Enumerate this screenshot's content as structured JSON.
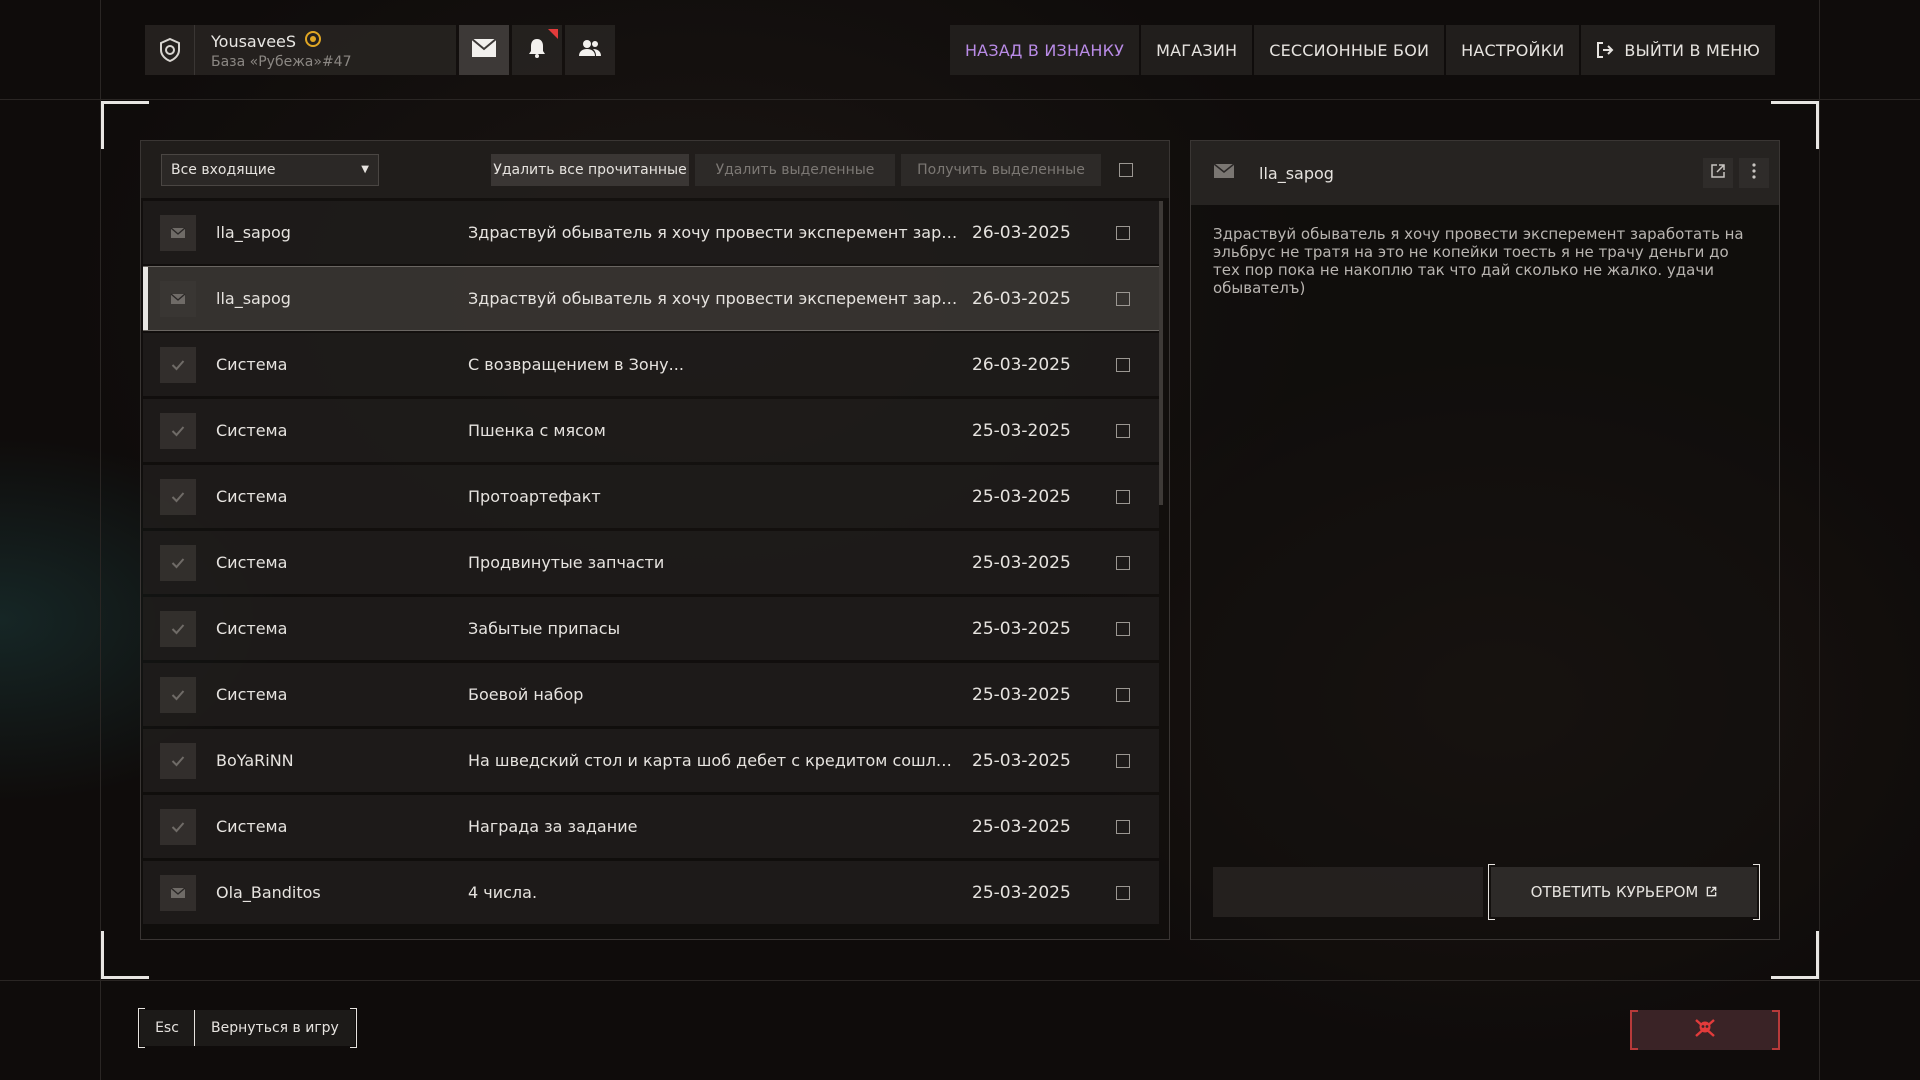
{
  "profile": {
    "name": "YousaveeS",
    "subtitle": "База «Рубежа»#47"
  },
  "topnav": {
    "items": [
      {
        "label": "НАЗАД В ИЗНАНКУ"
      },
      {
        "label": "МАГАЗИН"
      },
      {
        "label": "СЕССИОННЫЕ БОИ"
      },
      {
        "label": "НАСТРОЙКИ"
      },
      {
        "label": "ВЫЙТИ В МЕНЮ"
      }
    ],
    "accent_color": "#b98be6"
  },
  "inbox": {
    "filter_value": "Все входящие",
    "buttons": {
      "delete_read": "Удалить все прочитанные",
      "delete_selected": "Удалить выделенные",
      "get_selected": "Получить выделенные"
    },
    "messages": [
      {
        "icon": "envelope-icon",
        "sender": "lla_sapog",
        "subject": "Здраствуй обыватель я хочу провести эксперемент заработать на эльбрус не тратя на это не копейки тоесть я не трачу деньги до тех пор",
        "date": "26-03-2025",
        "selected": false
      },
      {
        "icon": "envelope-icon",
        "sender": "lla_sapog",
        "subject": "Здраствуй обыватель я хочу провести эксперемент заработать на эльбрус не тратя на это не копейки тоесть я не трачу деньги до тех пор",
        "date": "26-03-2025",
        "selected": true
      },
      {
        "icon": "check-icon",
        "sender": "Система",
        "subject": "С возвращением в Зону...",
        "date": "26-03-2025",
        "selected": false
      },
      {
        "icon": "check-icon",
        "sender": "Система",
        "subject": "Пшенка с мясом",
        "date": "25-03-2025",
        "selected": false
      },
      {
        "icon": "check-icon",
        "sender": "Система",
        "subject": "Протоартефакт",
        "date": "25-03-2025",
        "selected": false
      },
      {
        "icon": "check-icon",
        "sender": "Система",
        "subject": "Продвинутые запчасти",
        "date": "25-03-2025",
        "selected": false
      },
      {
        "icon": "check-icon",
        "sender": "Система",
        "subject": "Забытые припасы",
        "date": "25-03-2025",
        "selected": false
      },
      {
        "icon": "check-icon",
        "sender": "Система",
        "subject": "Боевой набор",
        "date": "25-03-2025",
        "selected": false
      },
      {
        "icon": "check-icon",
        "sender": "BoYaRiNN",
        "subject": "На шведский стол и карта шоб дебет с кредитом сошлись",
        "date": "25-03-2025",
        "selected": false
      },
      {
        "icon": "check-icon",
        "sender": "Система",
        "subject": "Награда за задание",
        "date": "25-03-2025",
        "selected": false
      },
      {
        "icon": "envelope-icon",
        "sender": "Ola_Banditos",
        "subject": "4 числа.",
        "date": "25-03-2025",
        "selected": false
      }
    ]
  },
  "reader": {
    "sender": "lla_sapog",
    "body": "Здраствуй обыватель я хочу провести эксперемент заработать на эльбрус не тратя на это не копейки тоесть я не трачу деньги до тех пор пока не накоплю так что дай сколько не жалко. удачи обывателъ)",
    "reply_label": "ОТВЕТИТЬ КУРЬЕРОМ"
  },
  "bottom": {
    "key": "Esc",
    "label": "Вернуться в игру"
  }
}
